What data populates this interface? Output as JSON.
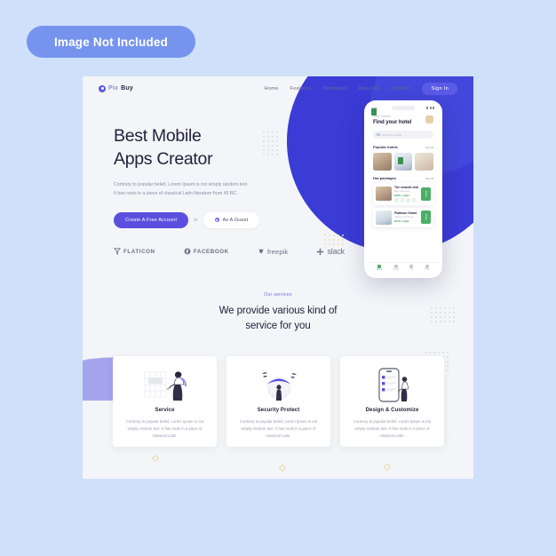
{
  "badge": {
    "label": "Image Not Included"
  },
  "nav": {
    "logo": {
      "first": "Pix",
      "second": "Buy",
      "icon": "pixbuy-logo-icon"
    },
    "links": [
      {
        "label": "Home"
      },
      {
        "label": "Features"
      },
      {
        "label": "Download"
      },
      {
        "label": "About Us"
      },
      {
        "label": "Contact"
      }
    ],
    "signin_label": "Sign In"
  },
  "hero": {
    "title_line1": "Best Mobile",
    "title_line2": "Apps Creator",
    "paragraph": "Contrary to popular belief, Lorem Ipsum is not simply random text. It has roots in a piece of classical Latin literature from 45 BC.",
    "primary_cta": "Create A Free Account",
    "or_text": "or",
    "secondary_cta": "As A Guest"
  },
  "brands": [
    {
      "name": "FLATICON",
      "icon": "flaticon-icon",
      "style": "upper"
    },
    {
      "name": "FACEBOOK",
      "icon": "facebook-icon",
      "style": "upper"
    },
    {
      "name": "freepik",
      "icon": "freepik-icon",
      "style": "lower"
    },
    {
      "name": "slack",
      "icon": "slack-icon",
      "style": "slack"
    }
  ],
  "services": {
    "kicker": "Our services",
    "title_line1": "We provide various kind of",
    "title_line2": "service for you",
    "cards": [
      {
        "title": "Service",
        "desc": "Contrary to popular belief, Lorem Ipsum is not simply random text. It has roots in a piece of classical Latin.",
        "art": "woman-with-chart-illustration"
      },
      {
        "title": "Security Protect",
        "desc": "Contrary to popular belief, Lorem Ipsum is not simply random text. It has roots in a piece of classical Latin.",
        "art": "umbrella-protection-illustration"
      },
      {
        "title": "Design & Customize",
        "desc": "Contrary to popular belief, Lorem Ipsum is not simply random text. It has roots in a piece of classical Latin.",
        "art": "phone-design-illustration"
      }
    ]
  },
  "phone": {
    "status": {
      "time": "9:41",
      "icons": "signal-wifi-battery-icons"
    },
    "greeting": "Hello Traveler",
    "heading": "Find your hotel",
    "search_placeholder": "Search for hotels",
    "popular": {
      "title": "Popular hotels",
      "link": "See all"
    },
    "packages": {
      "title": "Hot packages",
      "link": "See all"
    },
    "rows": [
      {
        "name": "The  seaside  chalet",
        "sub": "Bali, Indonesia",
        "price": "$180 / night",
        "button": "Book"
      },
      {
        "name": "Platinum Grand",
        "sub": "Jakarta, Indonesia",
        "price": "$210 / night",
        "button": "Book"
      }
    ],
    "tabs": [
      {
        "label": "Home",
        "active": true
      },
      {
        "label": "Search",
        "active": false
      },
      {
        "label": "Trip",
        "active": false
      },
      {
        "label": "Profile",
        "active": false
      }
    ]
  },
  "colors": {
    "page_bg": "#cfe0fb",
    "badge": "#7694ee",
    "accent_purple": "#5b4fe0",
    "deep_blue": "#3b3bd6",
    "blob_purple": "#a4a4ec",
    "canvas": "#f4f5f8",
    "green": "#4caf67",
    "gold": "#e8d9a6"
  }
}
